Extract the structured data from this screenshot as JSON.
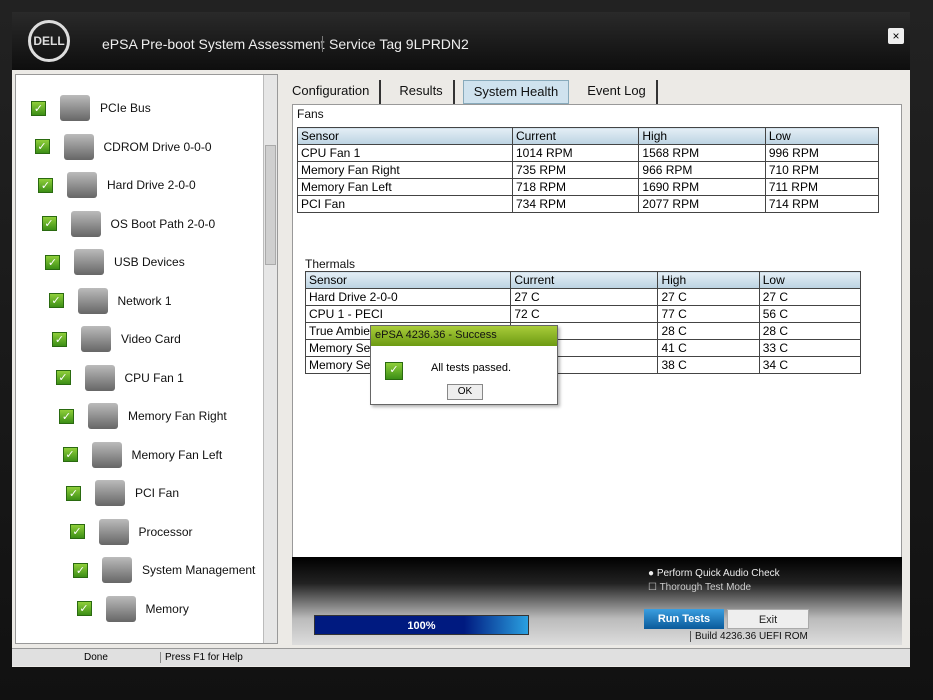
{
  "header": {
    "logo": "DELL",
    "title": "ePSA Pre-boot System Assessment",
    "service_tag": "Service Tag 9LPRDN2",
    "close": "×"
  },
  "devices": [
    {
      "label": "PCIe Bus",
      "icon": "pcie-bus-icon"
    },
    {
      "label": "CDROM Drive 0-0-0",
      "icon": "cdrom-icon"
    },
    {
      "label": "Hard Drive 2-0-0",
      "icon": "hard-drive-icon"
    },
    {
      "label": "OS Boot Path 2-0-0",
      "icon": "boot-path-icon"
    },
    {
      "label": "USB Devices",
      "icon": "usb-icon"
    },
    {
      "label": "Network 1",
      "icon": "network-icon"
    },
    {
      "label": "Video Card",
      "icon": "video-card-icon"
    },
    {
      "label": "CPU Fan 1",
      "icon": "fan-icon"
    },
    {
      "label": "Memory Fan Right",
      "icon": "fan-icon"
    },
    {
      "label": "Memory Fan Left",
      "icon": "fan-icon"
    },
    {
      "label": "PCI Fan",
      "icon": "fan-icon"
    },
    {
      "label": "Processor",
      "icon": "processor-icon"
    },
    {
      "label": "System Management",
      "icon": "system-management-icon"
    },
    {
      "label": "Memory",
      "icon": "memory-icon"
    }
  ],
  "tabs": [
    "Configuration",
    "Results",
    "System Health",
    "Event Log"
  ],
  "active_tab": "System Health",
  "fans": {
    "title": "Fans",
    "headers": [
      "Sensor",
      "Current",
      "High",
      "Low"
    ],
    "rows": [
      [
        "CPU Fan 1",
        "1014 RPM",
        "1568 RPM",
        "996 RPM"
      ],
      [
        "Memory Fan Right",
        "735 RPM",
        "966 RPM",
        "710 RPM"
      ],
      [
        "Memory Fan Left",
        "718 RPM",
        "1690 RPM",
        "711 RPM"
      ],
      [
        "PCI Fan",
        "734 RPM",
        "2077 RPM",
        "714 RPM"
      ]
    ]
  },
  "thermals": {
    "title": "Thermals",
    "headers": [
      "Sensor",
      "Current",
      "High",
      "Low"
    ],
    "rows": [
      [
        "Hard Drive 2-0-0",
        "27 C",
        "27 C",
        "27 C"
      ],
      [
        "CPU 1 - PECI",
        "72 C",
        "77 C",
        "56 C"
      ],
      [
        "True Ambie",
        "",
        "28 C",
        "28 C"
      ],
      [
        "Memory Se",
        "",
        "41 C",
        "33 C"
      ],
      [
        "Memory Se",
        "",
        "38 C",
        "34 C"
      ]
    ]
  },
  "dialog": {
    "title": "ePSA 4236.36 - Success",
    "message": "All tests passed.",
    "ok": "OK"
  },
  "options": {
    "audio": "Perform Quick Audio Check",
    "thorough": "Thorough Test Mode"
  },
  "progress": {
    "label": "100%",
    "value": 100
  },
  "buttons": {
    "run": "Run Tests",
    "exit": "Exit"
  },
  "build": "Build  4236.36 UEFI ROM",
  "status": {
    "left": "Done",
    "help": "Press F1 for Help"
  }
}
